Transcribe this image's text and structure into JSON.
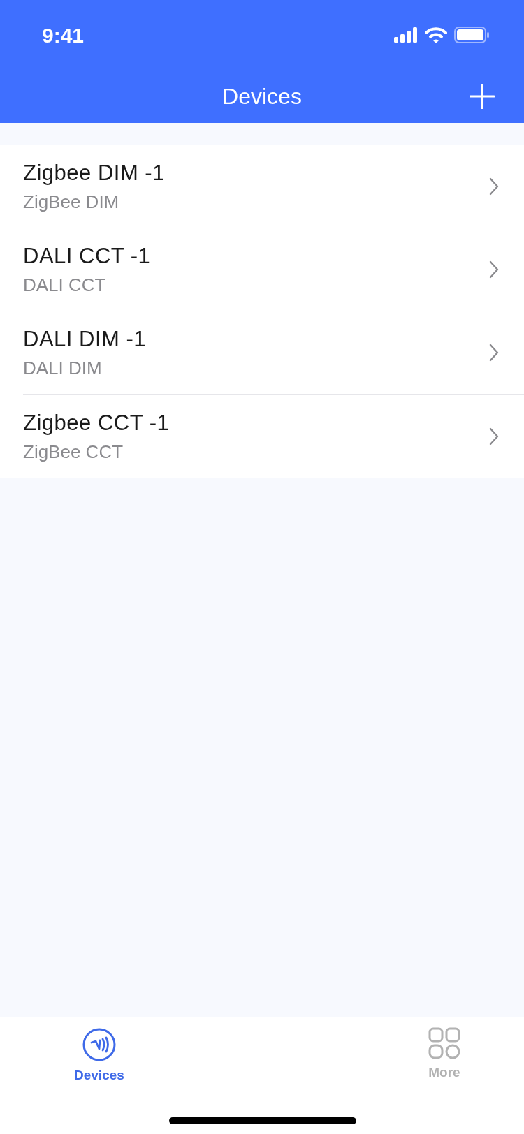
{
  "status_bar": {
    "time": "9:41"
  },
  "nav_bar": {
    "title": "Devices"
  },
  "devices": [
    {
      "name": "Zigbee DIM -1",
      "type": "ZigBee DIM"
    },
    {
      "name": "DALI CCT -1",
      "type": "DALI CCT"
    },
    {
      "name": "DALI DIM -1",
      "type": "DALI DIM"
    },
    {
      "name": "Zigbee CCT -1",
      "type": "ZigBee CCT"
    }
  ],
  "tab_bar": [
    {
      "label": "Devices",
      "kind": "nfc",
      "selected": true
    },
    {
      "label": "More",
      "kind": "grid",
      "selected": false
    }
  ]
}
